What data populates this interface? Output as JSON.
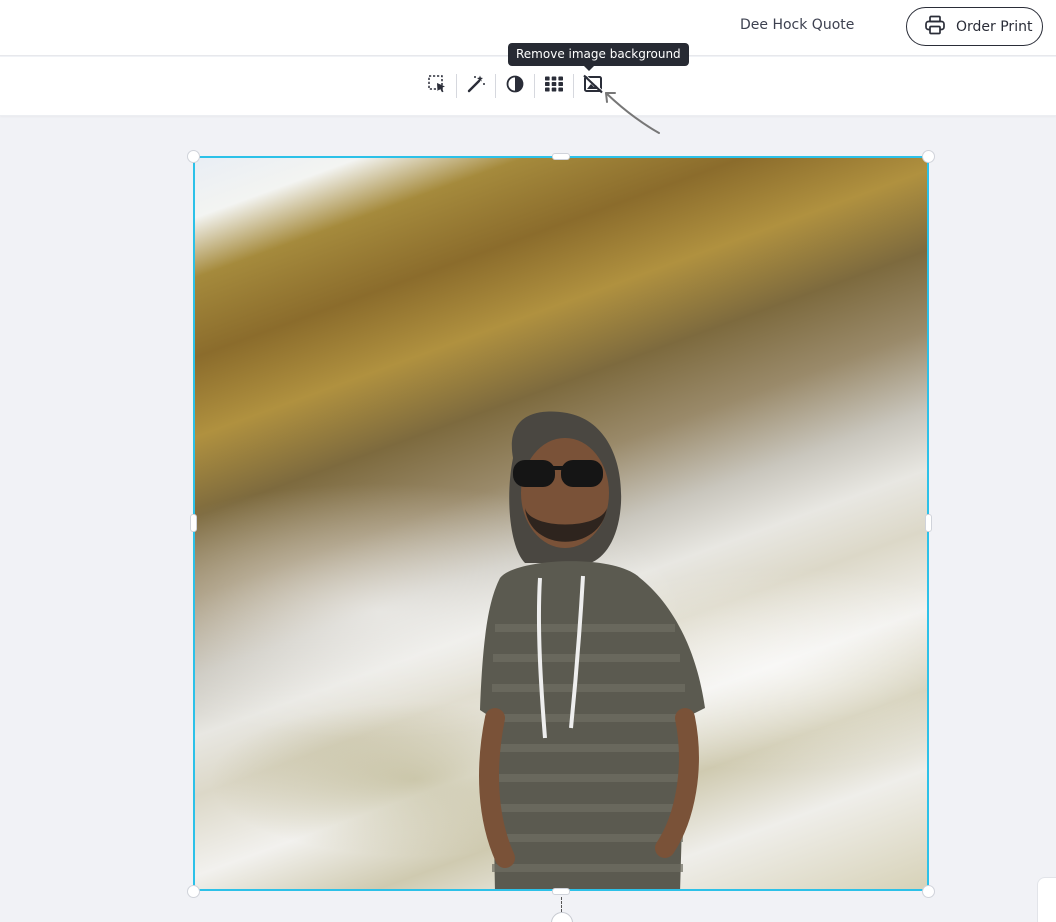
{
  "header": {
    "document_title": "Dee Hock Quote",
    "order_print_label": "Order Print"
  },
  "toolbar": {
    "tools": [
      {
        "name": "select-area-icon"
      },
      {
        "name": "magic-wand-icon"
      },
      {
        "name": "contrast-icon"
      },
      {
        "name": "grid-icon"
      },
      {
        "name": "remove-background-icon"
      }
    ],
    "tooltip": "Remove image background"
  },
  "canvas": {
    "selection_color": "#2cc1e8"
  }
}
